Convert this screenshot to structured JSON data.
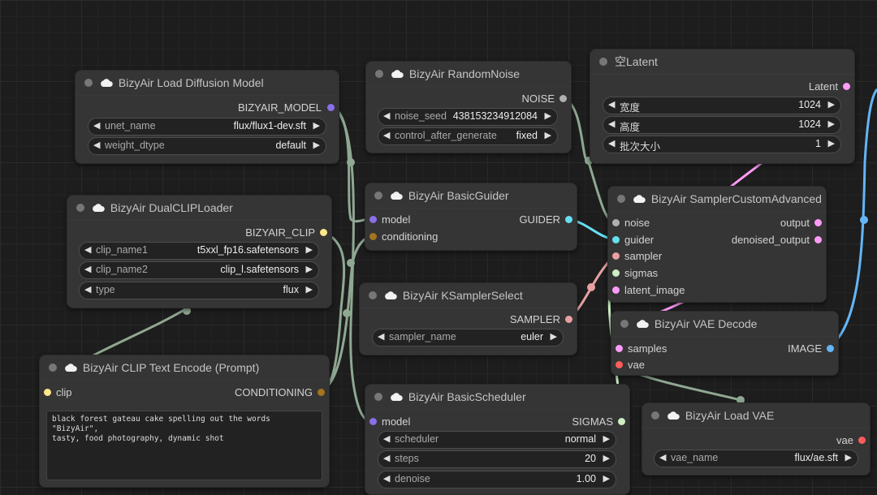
{
  "nodes": {
    "diffusion": {
      "title": "BizyAir Load Diffusion Model",
      "output": "BIZYAIR_MODEL",
      "widgets": [
        {
          "name": "unet_name",
          "value": "flux/flux1-dev.sft"
        },
        {
          "name": "weight_dtype",
          "value": "default"
        }
      ]
    },
    "noise": {
      "title": "BizyAir RandomNoise",
      "output": "NOISE",
      "widgets": [
        {
          "name": "noise_seed",
          "value": "438153234912084"
        },
        {
          "name": "control_after_generate",
          "value": "fixed"
        }
      ]
    },
    "latent": {
      "title": "空Latent",
      "output": "Latent",
      "widgets": [
        {
          "name": "宽度",
          "value": "1024"
        },
        {
          "name": "高度",
          "value": "1024"
        },
        {
          "name": "批次大小",
          "value": "1"
        }
      ]
    },
    "dualclip": {
      "title": "BizyAir DualCLIPLoader",
      "output": "BIZYAIR_CLIP",
      "widgets": [
        {
          "name": "clip_name1",
          "value": "t5xxl_fp16.safetensors"
        },
        {
          "name": "clip_name2",
          "value": "clip_l.safetensors"
        },
        {
          "name": "type",
          "value": "flux"
        }
      ]
    },
    "guider": {
      "title": "BizyAir BasicGuider",
      "inputs": [
        "model",
        "conditioning"
      ],
      "output": "GUIDER"
    },
    "sampler_adv": {
      "title": "BizyAir SamplerCustomAdvanced",
      "inputs": [
        "noise",
        "guider",
        "sampler",
        "sigmas",
        "latent_image"
      ],
      "outputs": [
        "output",
        "denoised_output"
      ]
    },
    "ksampler": {
      "title": "BizyAir KSamplerSelect",
      "output": "SAMPLER",
      "widgets": [
        {
          "name": "sampler_name",
          "value": "euler"
        }
      ]
    },
    "vae_decode": {
      "title": "BizyAir VAE Decode",
      "inputs": [
        "samples",
        "vae"
      ],
      "output": "IMAGE"
    },
    "clip_encode": {
      "title": "BizyAir CLIP Text Encode (Prompt)",
      "input": "clip",
      "output": "CONDITIONING",
      "text": "black forest gateau cake spelling out the words \"BizyAir\",\ntasty, food photography, dynamic shot"
    },
    "scheduler": {
      "title": "BizyAir BasicScheduler",
      "input": "model",
      "output": "SIGMAS",
      "widgets": [
        {
          "name": "scheduler",
          "value": "normal"
        },
        {
          "name": "steps",
          "value": "20"
        },
        {
          "name": "denoise",
          "value": "1.00"
        }
      ]
    },
    "vae_loader": {
      "title": "BizyAir Load VAE",
      "output": "vae",
      "widgets": [
        {
          "name": "vae_name",
          "value": "flux/ae.sft"
        }
      ]
    }
  },
  "icons": {
    "left_arrow": "◀",
    "right_arrow": "▶",
    "title_icon": "cloud-icon"
  },
  "colors": {
    "model": "#b39ddb",
    "clip": "#ffd54f",
    "conditioning": "#e09b2d",
    "noise": "#b0b0b0",
    "guider": "#66e0f0",
    "sampler": "#e8a0a0",
    "sigmas": "#cdeec4",
    "latent": "#ff9cf9",
    "vae": "#ff6e6e",
    "image": "#64b5f6"
  }
}
